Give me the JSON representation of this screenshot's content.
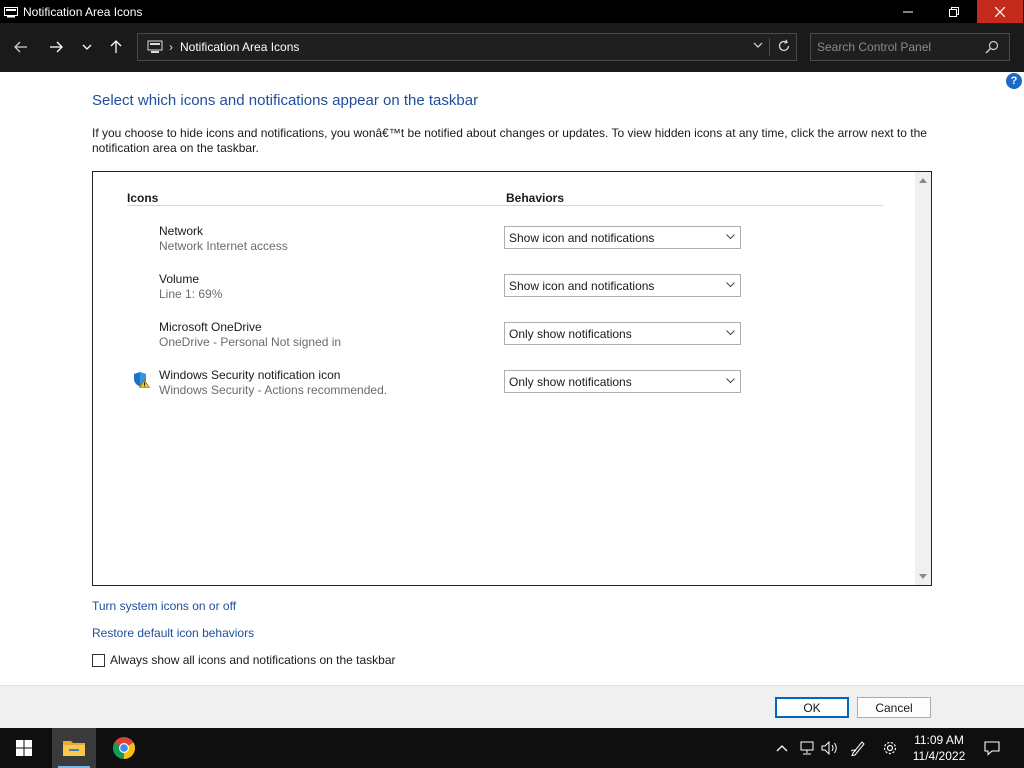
{
  "window": {
    "title": "Notification Area Icons"
  },
  "address_bar": {
    "path": "Notification Area Icons"
  },
  "search": {
    "placeholder": "Search Control Panel"
  },
  "content": {
    "heading": "Select which icons and notifications appear on the taskbar",
    "description": "If you choose to hide icons and notifications, you wonâ€™t be notified about changes or updates. To view hidden icons at any time, click the arrow next to the notification area on the taskbar.",
    "columns": {
      "icons": "Icons",
      "behaviors": "Behaviors"
    },
    "rows": [
      {
        "name": "Network",
        "subtitle": "Network Internet access",
        "behavior": "Show icon and notifications",
        "icon": ""
      },
      {
        "name": "Volume",
        "subtitle": "Line 1: 69%",
        "behavior": "Show icon and notifications",
        "icon": ""
      },
      {
        "name": "Microsoft OneDrive",
        "subtitle": "OneDrive - Personal Not signed in",
        "behavior": "Only show notifications",
        "icon": ""
      },
      {
        "name": "Windows Security notification icon",
        "subtitle": "Windows Security - Actions recommended.",
        "behavior": "Only show notifications",
        "icon": "windows-security-warning-icon"
      }
    ],
    "links": {
      "system_icons": "Turn system icons on or off",
      "restore_defaults": "Restore default icon behaviors"
    },
    "always_show": {
      "label": "Always show all icons and notifications on the taskbar",
      "checked": false
    }
  },
  "buttons": {
    "ok": "OK",
    "cancel": "Cancel"
  },
  "taskbar": {
    "time": "11:09 AM",
    "date": "11/4/2022"
  },
  "colors": {
    "link": "#1e4e9c",
    "close_button": "#c42b1c",
    "help": "#1b6ac9"
  }
}
